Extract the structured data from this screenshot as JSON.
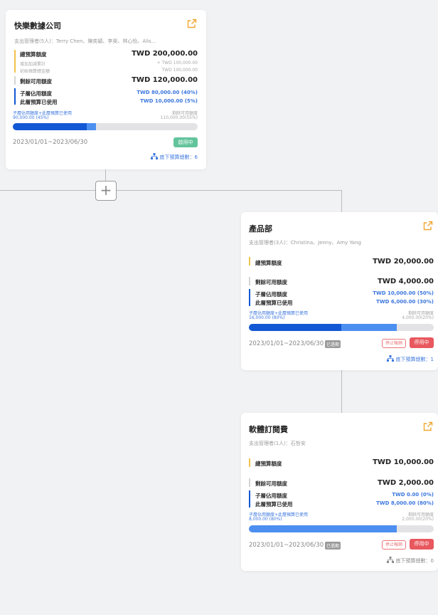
{
  "colors": {
    "accent_blue": "#3c77de",
    "bar_dark": "#1258d4",
    "bar_light": "#4d8ff0",
    "yellow": "#f0c24b",
    "status_active": "#63c49b",
    "status_disabled": "#e8585e"
  },
  "add_button": {
    "label": "+"
  },
  "cards": [
    {
      "title": "快樂數據公司",
      "managers": "支出管理者(5人)：Terry Chen、陳奕穎、李昊、林心怡、Alis...",
      "total_label": "總預算額度",
      "total_value": "TWD 200,000.00",
      "add_label": "增加加減累計",
      "add_value": "+ TWD 100,000.00",
      "initial_label": "初始預算總金額",
      "initial_value": "TWD 100,000.00",
      "remain_label": "剩餘可用額度",
      "remain_value": "TWD 120,000.00",
      "child_label": "子層佔用額度",
      "child_value": "TWD 80,000.00 (40%)",
      "used_label": "此層預算已使用",
      "used_value": "TWD 10,000.00 (5%)",
      "progress_left_label": "子層佔用額度+此層預算已使用",
      "progress_left_value": "90,000.00 (45%)",
      "progress_right_label": "剩餘可用額度",
      "progress_right_value": "110,000.00(55%)",
      "progress": {
        "child_pct": 40,
        "used_pct": 5
      },
      "date": "2023/01/01~2023/06/30",
      "status": "啟用中",
      "children_link": "底下預算總數：6"
    },
    {
      "title": "產品部",
      "managers": "支出管理者(3人)：Christina、Jenny、Amy Yang",
      "total_label": "總預算額度",
      "total_value": "TWD 20,000.00",
      "remain_label": "剩餘可用額度",
      "remain_value": "TWD 4,000.00",
      "child_label": "子層佔用額度",
      "child_value": "TWD 10,000.00 (50%)",
      "used_label": "此層預算已使用",
      "used_value": "TWD 6,000.00 (30%)",
      "progress_left_label": "子層佔用額度+此層預算已使用",
      "progress_left_value": "16,000.00 (80%)",
      "progress_right_label": "剩餘可用額度",
      "progress_right_value": "4,000.00(20%)",
      "progress": {
        "child_pct": 50,
        "used_pct": 30
      },
      "date": "2023/01/01~2023/06/30",
      "expired_badge": "已過期",
      "stop_button": "停止報銷",
      "status": "停用中",
      "children_link": "底下預算總數：1"
    },
    {
      "title": "軟體訂閱費",
      "managers": "支出管理者(1人)：石哲安",
      "total_label": "總預算額度",
      "total_value": "TWD 10,000.00",
      "remain_label": "剩餘可用額度",
      "remain_value": "TWD 2,000.00",
      "child_label": "子層佔用額度",
      "child_value": "TWD 0.00 (0%)",
      "used_label": "此層預算已使用",
      "used_value": "TWD 8,000.00 (80%)",
      "progress_left_label": "子層佔用額度+此層預算已使用",
      "progress_left_value": "8,000.00 (80%)",
      "progress_right_label": "剩餘可用額度",
      "progress_right_value": "2,000.00(20%)",
      "progress": {
        "child_pct": 0,
        "used_pct": 80
      },
      "date": "2023/01/01~2023/06/30",
      "expired_badge": "已過期",
      "stop_button": "停止報銷",
      "status": "停用中",
      "children_link": "底下預算總數：0"
    }
  ]
}
